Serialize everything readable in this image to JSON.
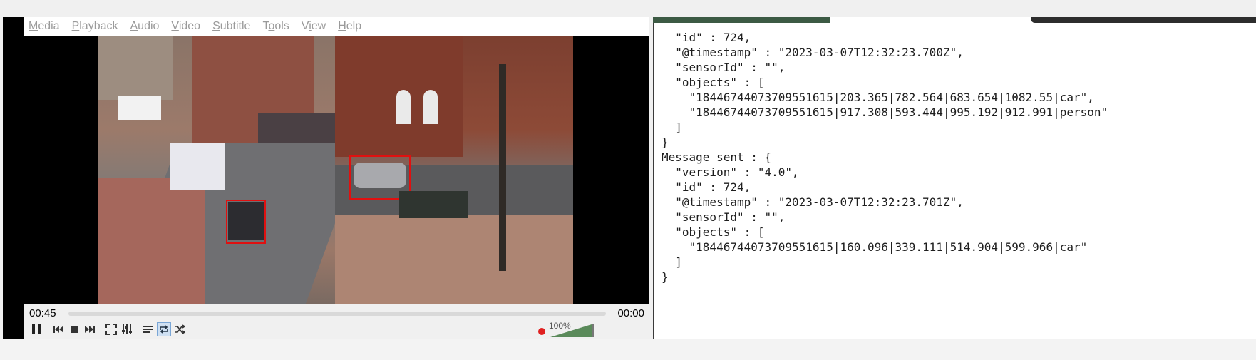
{
  "vlc": {
    "menu": [
      "Media",
      "Playback",
      "Audio",
      "Video",
      "Subtitle",
      "Tools",
      "View",
      "Help"
    ],
    "menu_underline": [
      "M",
      "P",
      "A",
      "V",
      "S",
      "o",
      "i",
      "H"
    ],
    "time_current": "00:45",
    "time_end": "00:00",
    "seek_fraction": 0.0,
    "volume_label": "100%",
    "volume_fraction": 1.0,
    "icons": {
      "pause": "pause-icon",
      "prev": "skip-back-icon",
      "stop": "stop-icon",
      "next": "skip-forward-icon",
      "fullscreen": "fullscreen-icon",
      "extended": "equalizer-icon",
      "playlist": "playlist-icon",
      "loop": "loop-icon",
      "shuffle": "shuffle-icon",
      "mute": "speaker-muted-icon"
    },
    "bbox_color": "#e01010"
  },
  "terminal": {
    "lines": [
      "  \"id\" : 724,",
      "  \"@timestamp\" : \"2023-03-07T12:32:23.700Z\",",
      "  \"sensorId\" : \"\",",
      "  \"objects\" : [",
      "    \"18446744073709551615|203.365|782.564|683.654|1082.55|car\",",
      "    \"18446744073709551615|917.308|593.444|995.192|912.991|person\"",
      "  ]",
      "}",
      "Message sent : {",
      "  \"version\" : \"4.0\",",
      "  \"id\" : 724,",
      "  \"@timestamp\" : \"2023-03-07T12:32:23.701Z\",",
      "  \"sensorId\" : \"\",",
      "  \"objects\" : [",
      "    \"18446744073709551615|160.096|339.111|514.904|599.966|car\"",
      "  ]",
      "}"
    ]
  }
}
